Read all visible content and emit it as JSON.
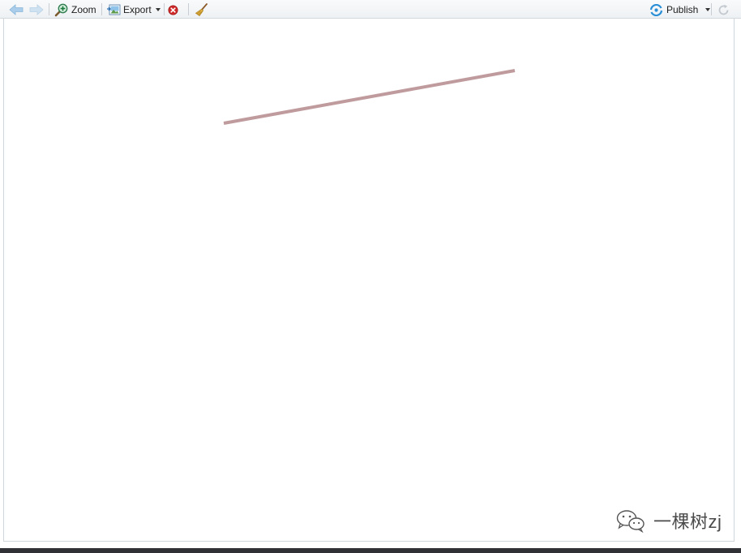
{
  "toolbar": {
    "zoom_label": "Zoom",
    "export_label": "Export",
    "publish_label": "Publish",
    "icons": {
      "back": "arrow-left-icon",
      "forward": "arrow-right-icon",
      "zoom": "magnifier-plus-icon",
      "export": "export-image-icon",
      "remove": "remove-plot-icon",
      "clear": "broom-icon",
      "publish": "publish-icon",
      "refresh": "refresh-icon"
    }
  },
  "plot": {
    "line_color": "#bf9b9e"
  },
  "watermark": {
    "text": "一棵树zj"
  }
}
